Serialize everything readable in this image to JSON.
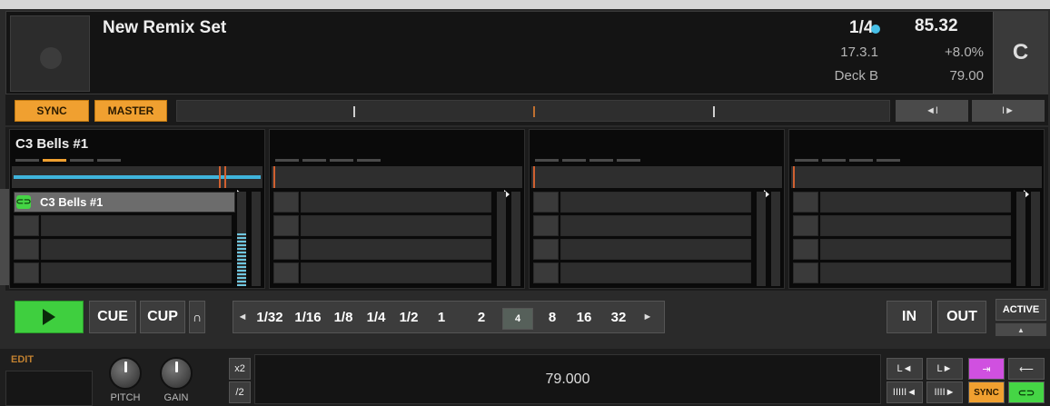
{
  "header": {
    "title": "New Remix Set",
    "quantize": "1/4",
    "position": "17.3.1",
    "deck_label": "Deck B",
    "bpm": "85.32",
    "tempo_offset": "+8.0%",
    "original_bpm": "79.00",
    "deck_letter": "C"
  },
  "sync_row": {
    "sync_label": "SYNC",
    "master_label": "MASTER",
    "nav_left_icon": "◄I",
    "nav_right_icon": "I►"
  },
  "slots": [
    {
      "name": "C3 Bells #1",
      "cell1_label": "C3 Bells #1"
    },
    {
      "name": ""
    },
    {
      "name": ""
    },
    {
      "name": ""
    }
  ],
  "transport": {
    "play_icon": "play-icon",
    "cue_label": "CUE",
    "cup_label": "CUP",
    "flux_label": "∩",
    "loop_prev": "◄",
    "loop_next": "►",
    "loop_sizes": [
      "1/32",
      "1/16",
      "1/8",
      "1/4",
      "1/2",
      "1",
      "2",
      "4",
      "8",
      "16",
      "32"
    ],
    "loop_active": "4",
    "in_label": "IN",
    "out_label": "OUT",
    "active_label": "ACTIVE",
    "active_sub": "▲"
  },
  "bottom": {
    "edit_label": "EDIT",
    "pitch_label": "PITCH",
    "gain_label": "GAIN",
    "x2_label": "x2",
    "div2_label": "/2",
    "tempo_value": "79.000",
    "btn_jump_back": "L◄",
    "btn_jump_fwd": "L►",
    "btn_rev": "IIIII◄",
    "btn_fwd": "IIII►",
    "btn_sync": "SYNC",
    "btn_loop": "⊂⊃"
  },
  "colors": {
    "accent_orange": "#f0a030",
    "play_green": "#3fcf3f",
    "cyan": "#47c0e8",
    "purple": "#d050e0"
  }
}
